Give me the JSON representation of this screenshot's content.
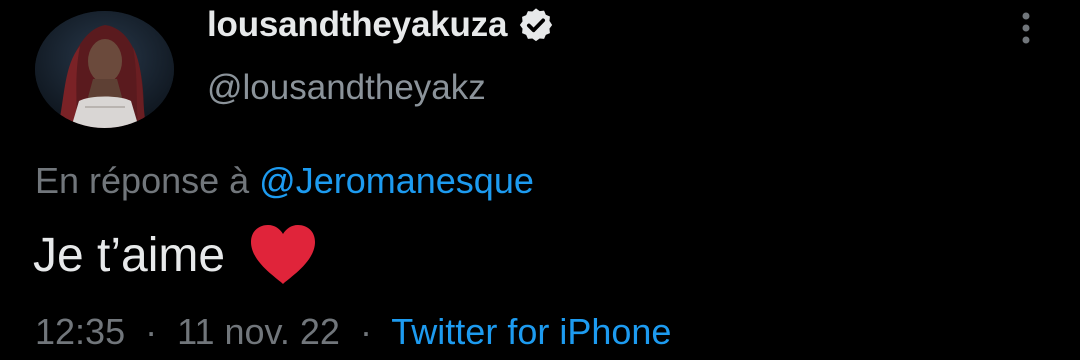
{
  "tweet": {
    "display_name": "lousandtheyakuza",
    "handle": "@lousandtheyakz",
    "verified": true,
    "reply_prefix": "En réponse à",
    "reply_to": "@Jeromanesque",
    "text": "Je t’aime",
    "emoji": "red-heart",
    "time": "12:35",
    "separator": "·",
    "date": "11 nov. 22",
    "source": "Twitter for iPhone"
  },
  "icons": {
    "more": "vertical-ellipsis-icon",
    "verified": "verified-badge-icon",
    "heart": "red-heart-emoji"
  },
  "colors": {
    "background": "#000000",
    "primary_text": "#e7e9ea",
    "secondary_text": "#71767b",
    "link": "#1d9bf0",
    "heart": "#e0243a"
  }
}
